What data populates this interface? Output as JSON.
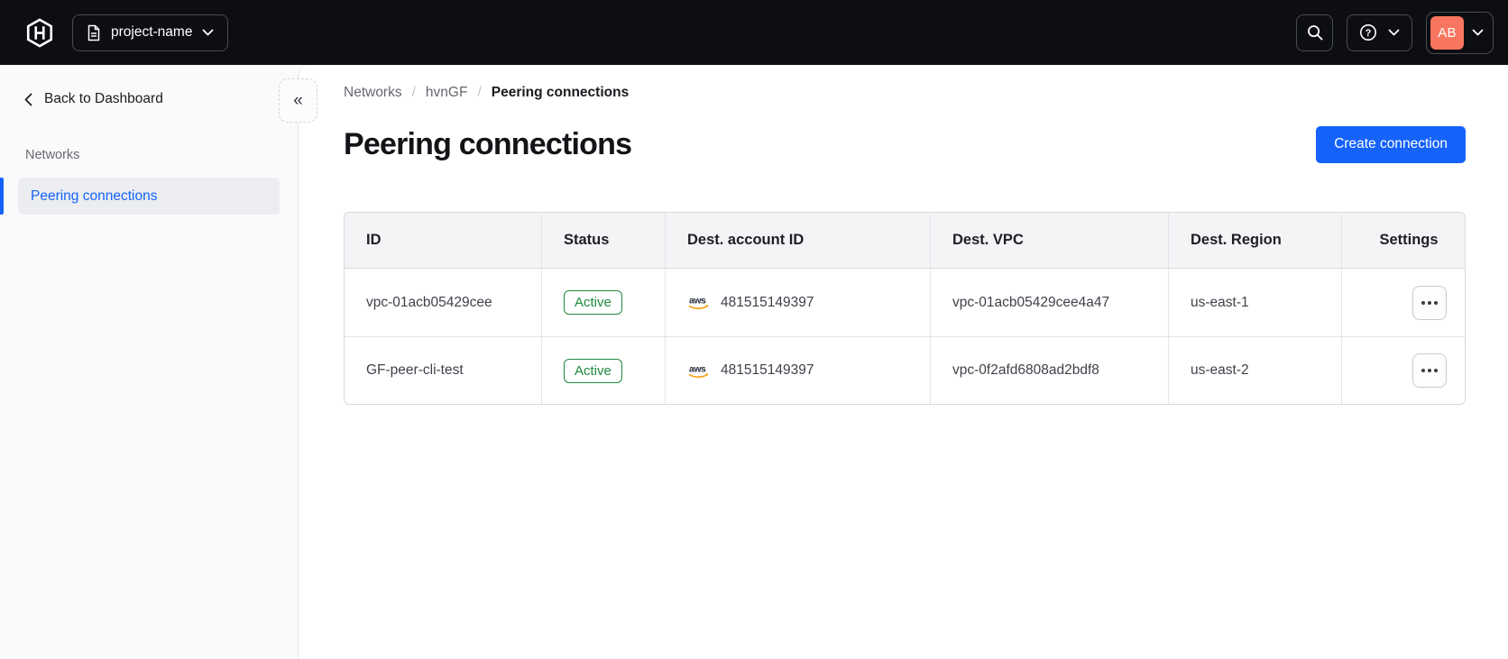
{
  "colors": {
    "topbar_bg": "#0d0e12",
    "accent_blue": "#1563fb",
    "success_green": "#1f8a3d",
    "avatar_coral": "#f8765f"
  },
  "topbar": {
    "project_switcher_label": "project-name",
    "account_initials": "AB"
  },
  "sidebar": {
    "back_label": "Back to Dashboard",
    "section_label": "Networks",
    "active_item_label": "Peering connections"
  },
  "breadcrumb": {
    "separator": "/",
    "items": [
      "Networks",
      "hvnGF",
      "Peering connections"
    ]
  },
  "page": {
    "title": "Peering connections",
    "create_button_label": "Create connection"
  },
  "table": {
    "columns": [
      "ID",
      "Status",
      "Dest. account ID",
      "Dest. VPC",
      "Dest. Region",
      "Settings"
    ],
    "rows": [
      {
        "id": "vpc-01acb05429cee",
        "status": "Active",
        "provider": "aws",
        "dest_account_id": "481515149397",
        "dest_vpc": "vpc-01acb05429cee4a47",
        "dest_region": "us-east-1"
      },
      {
        "id": "GF-peer-cli-test",
        "status": "Active",
        "provider": "aws",
        "dest_account_id": "481515149397",
        "dest_vpc": "vpc-0f2afd6808ad2bdf8",
        "dest_region": "us-east-2"
      }
    ]
  }
}
